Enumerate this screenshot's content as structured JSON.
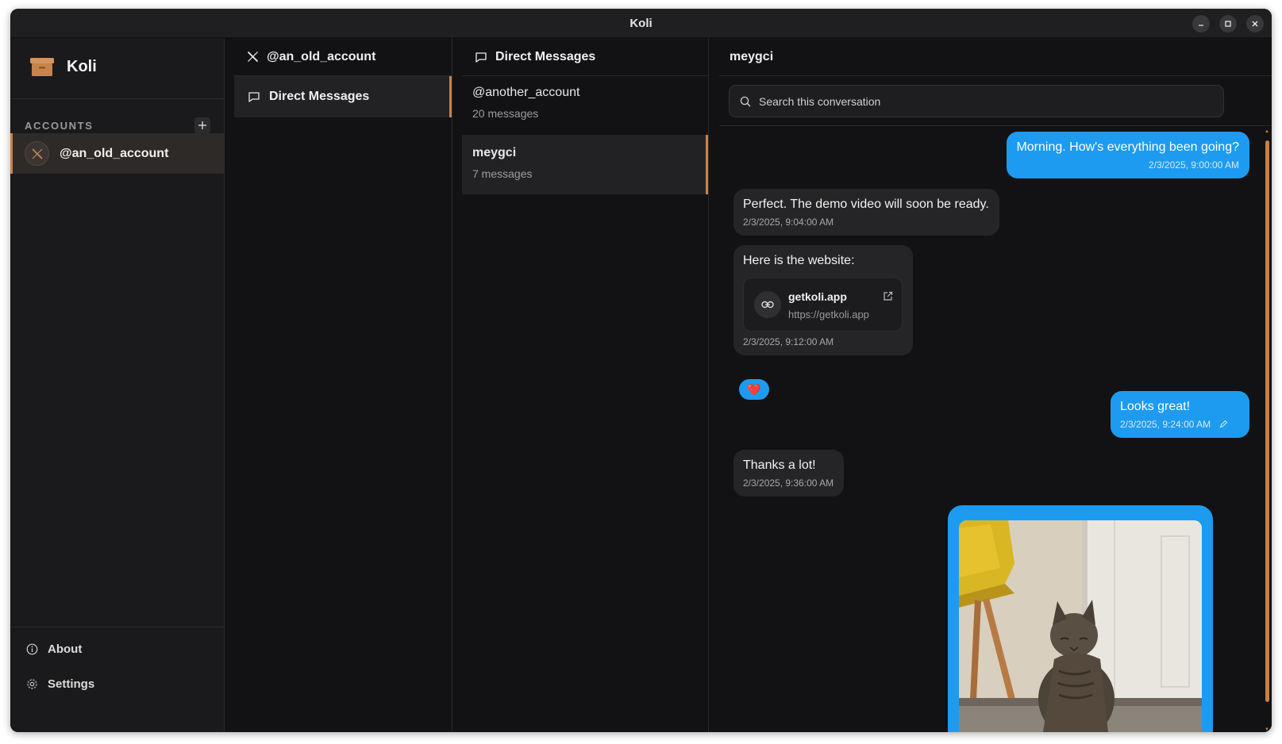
{
  "window": {
    "title": "Koli"
  },
  "sidebar": {
    "brand": "Koli",
    "accounts_label": "ACCOUNTS",
    "add_icon": "plus-icon",
    "accounts": [
      {
        "name": "@an_old_account",
        "icon": "x-logo-icon"
      }
    ],
    "footer": [
      {
        "label": "About",
        "icon": "info-icon"
      },
      {
        "label": "Settings",
        "icon": "gear-icon"
      }
    ]
  },
  "account_panel": {
    "title": "@an_old_account",
    "nav": [
      {
        "label": "Direct Messages",
        "icon": "chat-bubble-icon"
      }
    ]
  },
  "conversations_panel": {
    "title": "Direct Messages",
    "items": [
      {
        "name": "@another_account",
        "count": "20 messages"
      },
      {
        "name": "meygci",
        "count": "7 messages"
      }
    ]
  },
  "chat": {
    "title": "meygci",
    "search_placeholder": "Search this conversation",
    "messages": [
      {
        "direction": "out",
        "text": "Morning. How's everything been going?",
        "time": "2/3/2025, 9:00:00 AM"
      },
      {
        "direction": "in",
        "text": "Perfect. The demo video will soon be ready.",
        "time": "2/3/2025, 9:04:00 AM"
      },
      {
        "direction": "in",
        "text": "Here is the website:",
        "time": "2/3/2025, 9:12:00 AM",
        "link": {
          "title": "getkoli.app",
          "url": "https://getkoli.app"
        },
        "reaction": "❤️"
      },
      {
        "direction": "out",
        "text": "Looks great!",
        "time": "2/3/2025, 9:24:00 AM",
        "edited_icon": "pencil-icon"
      },
      {
        "direction": "in",
        "text": "Thanks a lot!",
        "time": "2/3/2025, 9:36:00 AM"
      },
      {
        "direction": "out",
        "image": "cat-photo"
      }
    ]
  },
  "colors": {
    "accent": "#c8834a",
    "outgoing": "#1d9bf0",
    "background": "#121214"
  }
}
